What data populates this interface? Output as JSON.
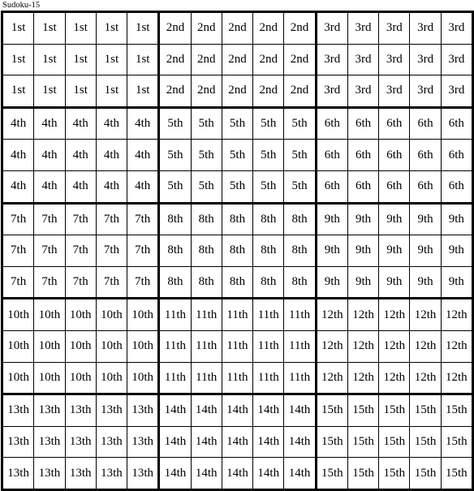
{
  "title": "Sudoku-15",
  "grid": {
    "rows": 15,
    "cols": 15,
    "block_rows": 3,
    "block_cols": 5,
    "cell_border_color": "#000000",
    "block_border_color": "#000000",
    "cell_background": "#ffffff",
    "text_color": "#000000",
    "cells": [
      [
        "1st",
        "1st",
        "1st",
        "1st",
        "1st",
        "2nd",
        "2nd",
        "2nd",
        "2nd",
        "2nd",
        "3rd",
        "3rd",
        "3rd",
        "3rd",
        "3rd"
      ],
      [
        "1st",
        "1st",
        "1st",
        "1st",
        "1st",
        "2nd",
        "2nd",
        "2nd",
        "2nd",
        "2nd",
        "3rd",
        "3rd",
        "3rd",
        "3rd",
        "3rd"
      ],
      [
        "1st",
        "1st",
        "1st",
        "1st",
        "1st",
        "2nd",
        "2nd",
        "2nd",
        "2nd",
        "2nd",
        "3rd",
        "3rd",
        "3rd",
        "3rd",
        "3rd"
      ],
      [
        "4th",
        "4th",
        "4th",
        "4th",
        "4th",
        "5th",
        "5th",
        "5th",
        "5th",
        "5th",
        "6th",
        "6th",
        "6th",
        "6th",
        "6th"
      ],
      [
        "4th",
        "4th",
        "4th",
        "4th",
        "4th",
        "5th",
        "5th",
        "5th",
        "5th",
        "5th",
        "6th",
        "6th",
        "6th",
        "6th",
        "6th"
      ],
      [
        "4th",
        "4th",
        "4th",
        "4th",
        "4th",
        "5th",
        "5th",
        "5th",
        "5th",
        "5th",
        "6th",
        "6th",
        "6th",
        "6th",
        "6th"
      ],
      [
        "7th",
        "7th",
        "7th",
        "7th",
        "7th",
        "8th",
        "8th",
        "8th",
        "8th",
        "8th",
        "9th",
        "9th",
        "9th",
        "9th",
        "9th"
      ],
      [
        "7th",
        "7th",
        "7th",
        "7th",
        "7th",
        "8th",
        "8th",
        "8th",
        "8th",
        "8th",
        "9th",
        "9th",
        "9th",
        "9th",
        "9th"
      ],
      [
        "7th",
        "7th",
        "7th",
        "7th",
        "7th",
        "8th",
        "8th",
        "8th",
        "8th",
        "8th",
        "9th",
        "9th",
        "9th",
        "9th",
        "9th"
      ],
      [
        "10th",
        "10th",
        "10th",
        "10th",
        "10th",
        "11th",
        "11th",
        "11th",
        "11th",
        "11th",
        "12th",
        "12th",
        "12th",
        "12th",
        "12th"
      ],
      [
        "10th",
        "10th",
        "10th",
        "10th",
        "10th",
        "11th",
        "11th",
        "11th",
        "11th",
        "11th",
        "12th",
        "12th",
        "12th",
        "12th",
        "12th"
      ],
      [
        "10th",
        "10th",
        "10th",
        "10th",
        "10th",
        "11th",
        "11th",
        "11th",
        "11th",
        "11th",
        "12th",
        "12th",
        "12th",
        "12th",
        "12th"
      ],
      [
        "13th",
        "13th",
        "13th",
        "13th",
        "13th",
        "14th",
        "14th",
        "14th",
        "14th",
        "14th",
        "15th",
        "15th",
        "15th",
        "15th",
        "15th"
      ],
      [
        "13th",
        "13th",
        "13th",
        "13th",
        "13th",
        "14th",
        "14th",
        "14th",
        "14th",
        "14th",
        "15th",
        "15th",
        "15th",
        "15th",
        "15th"
      ],
      [
        "13th",
        "13th",
        "13th",
        "13th",
        "13th",
        "14th",
        "14th",
        "14th",
        "14th",
        "14th",
        "15th",
        "15th",
        "15th",
        "15th",
        "15th"
      ]
    ]
  }
}
